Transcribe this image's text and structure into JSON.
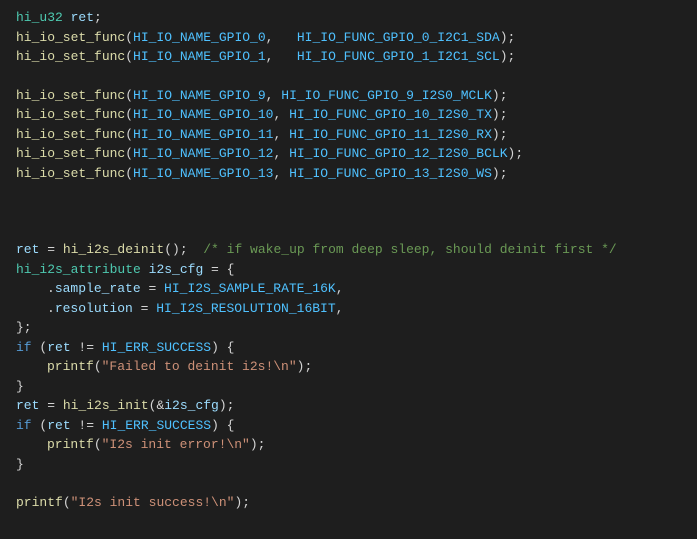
{
  "lines": {
    "l1_type": "hi_u32",
    "l1_var": "ret",
    "l2_fn": "hi_io_set_func",
    "l2_a1": "HI_IO_NAME_GPIO_0",
    "l2_a2": "HI_IO_FUNC_GPIO_0_I2C1_SDA",
    "l3_fn": "hi_io_set_func",
    "l3_a1": "HI_IO_NAME_GPIO_1",
    "l3_a2": "HI_IO_FUNC_GPIO_1_I2C1_SCL",
    "l5_fn": "hi_io_set_func",
    "l5_a1": "HI_IO_NAME_GPIO_9",
    "l5_a2": "HI_IO_FUNC_GPIO_9_I2S0_MCLK",
    "l6_fn": "hi_io_set_func",
    "l6_a1": "HI_IO_NAME_GPIO_10",
    "l6_a2": "HI_IO_FUNC_GPIO_10_I2S0_TX",
    "l7_fn": "hi_io_set_func",
    "l7_a1": "HI_IO_NAME_GPIO_11",
    "l7_a2": "HI_IO_FUNC_GPIO_11_I2S0_RX",
    "l8_fn": "hi_io_set_func",
    "l8_a1": "HI_IO_NAME_GPIO_12",
    "l8_a2": "HI_IO_FUNC_GPIO_12_I2S0_BCLK",
    "l9_fn": "hi_io_set_func",
    "l9_a1": "HI_IO_NAME_GPIO_13",
    "l9_a2": "HI_IO_FUNC_GPIO_13_I2S0_WS",
    "l13_var": "ret",
    "l13_fn": "hi_i2s_deinit",
    "l13_com": "/* if wake_up from deep sleep, should deinit first */",
    "l14_type": "hi_i2s_attribute",
    "l14_var": "i2s_cfg",
    "l15_field": "sample_rate",
    "l15_val": "HI_I2S_SAMPLE_RATE_16K",
    "l16_field": "resolution",
    "l16_val": "HI_I2S_RESOLUTION_16BIT",
    "l18_kw": "if",
    "l18_var": "ret",
    "l18_cmp": "HI_ERR_SUCCESS",
    "l19_fn": "printf",
    "l19_str": "\"Failed to deinit i2s!\\n\"",
    "l21_var": "ret",
    "l21_fn": "hi_i2s_init",
    "l21_arg": "i2s_cfg",
    "l22_kw": "if",
    "l22_var": "ret",
    "l22_cmp": "HI_ERR_SUCCESS",
    "l23_fn": "printf",
    "l23_str": "\"I2s init error!\\n\"",
    "l26_fn": "printf",
    "l26_str": "\"I2s init success!\\n\""
  }
}
